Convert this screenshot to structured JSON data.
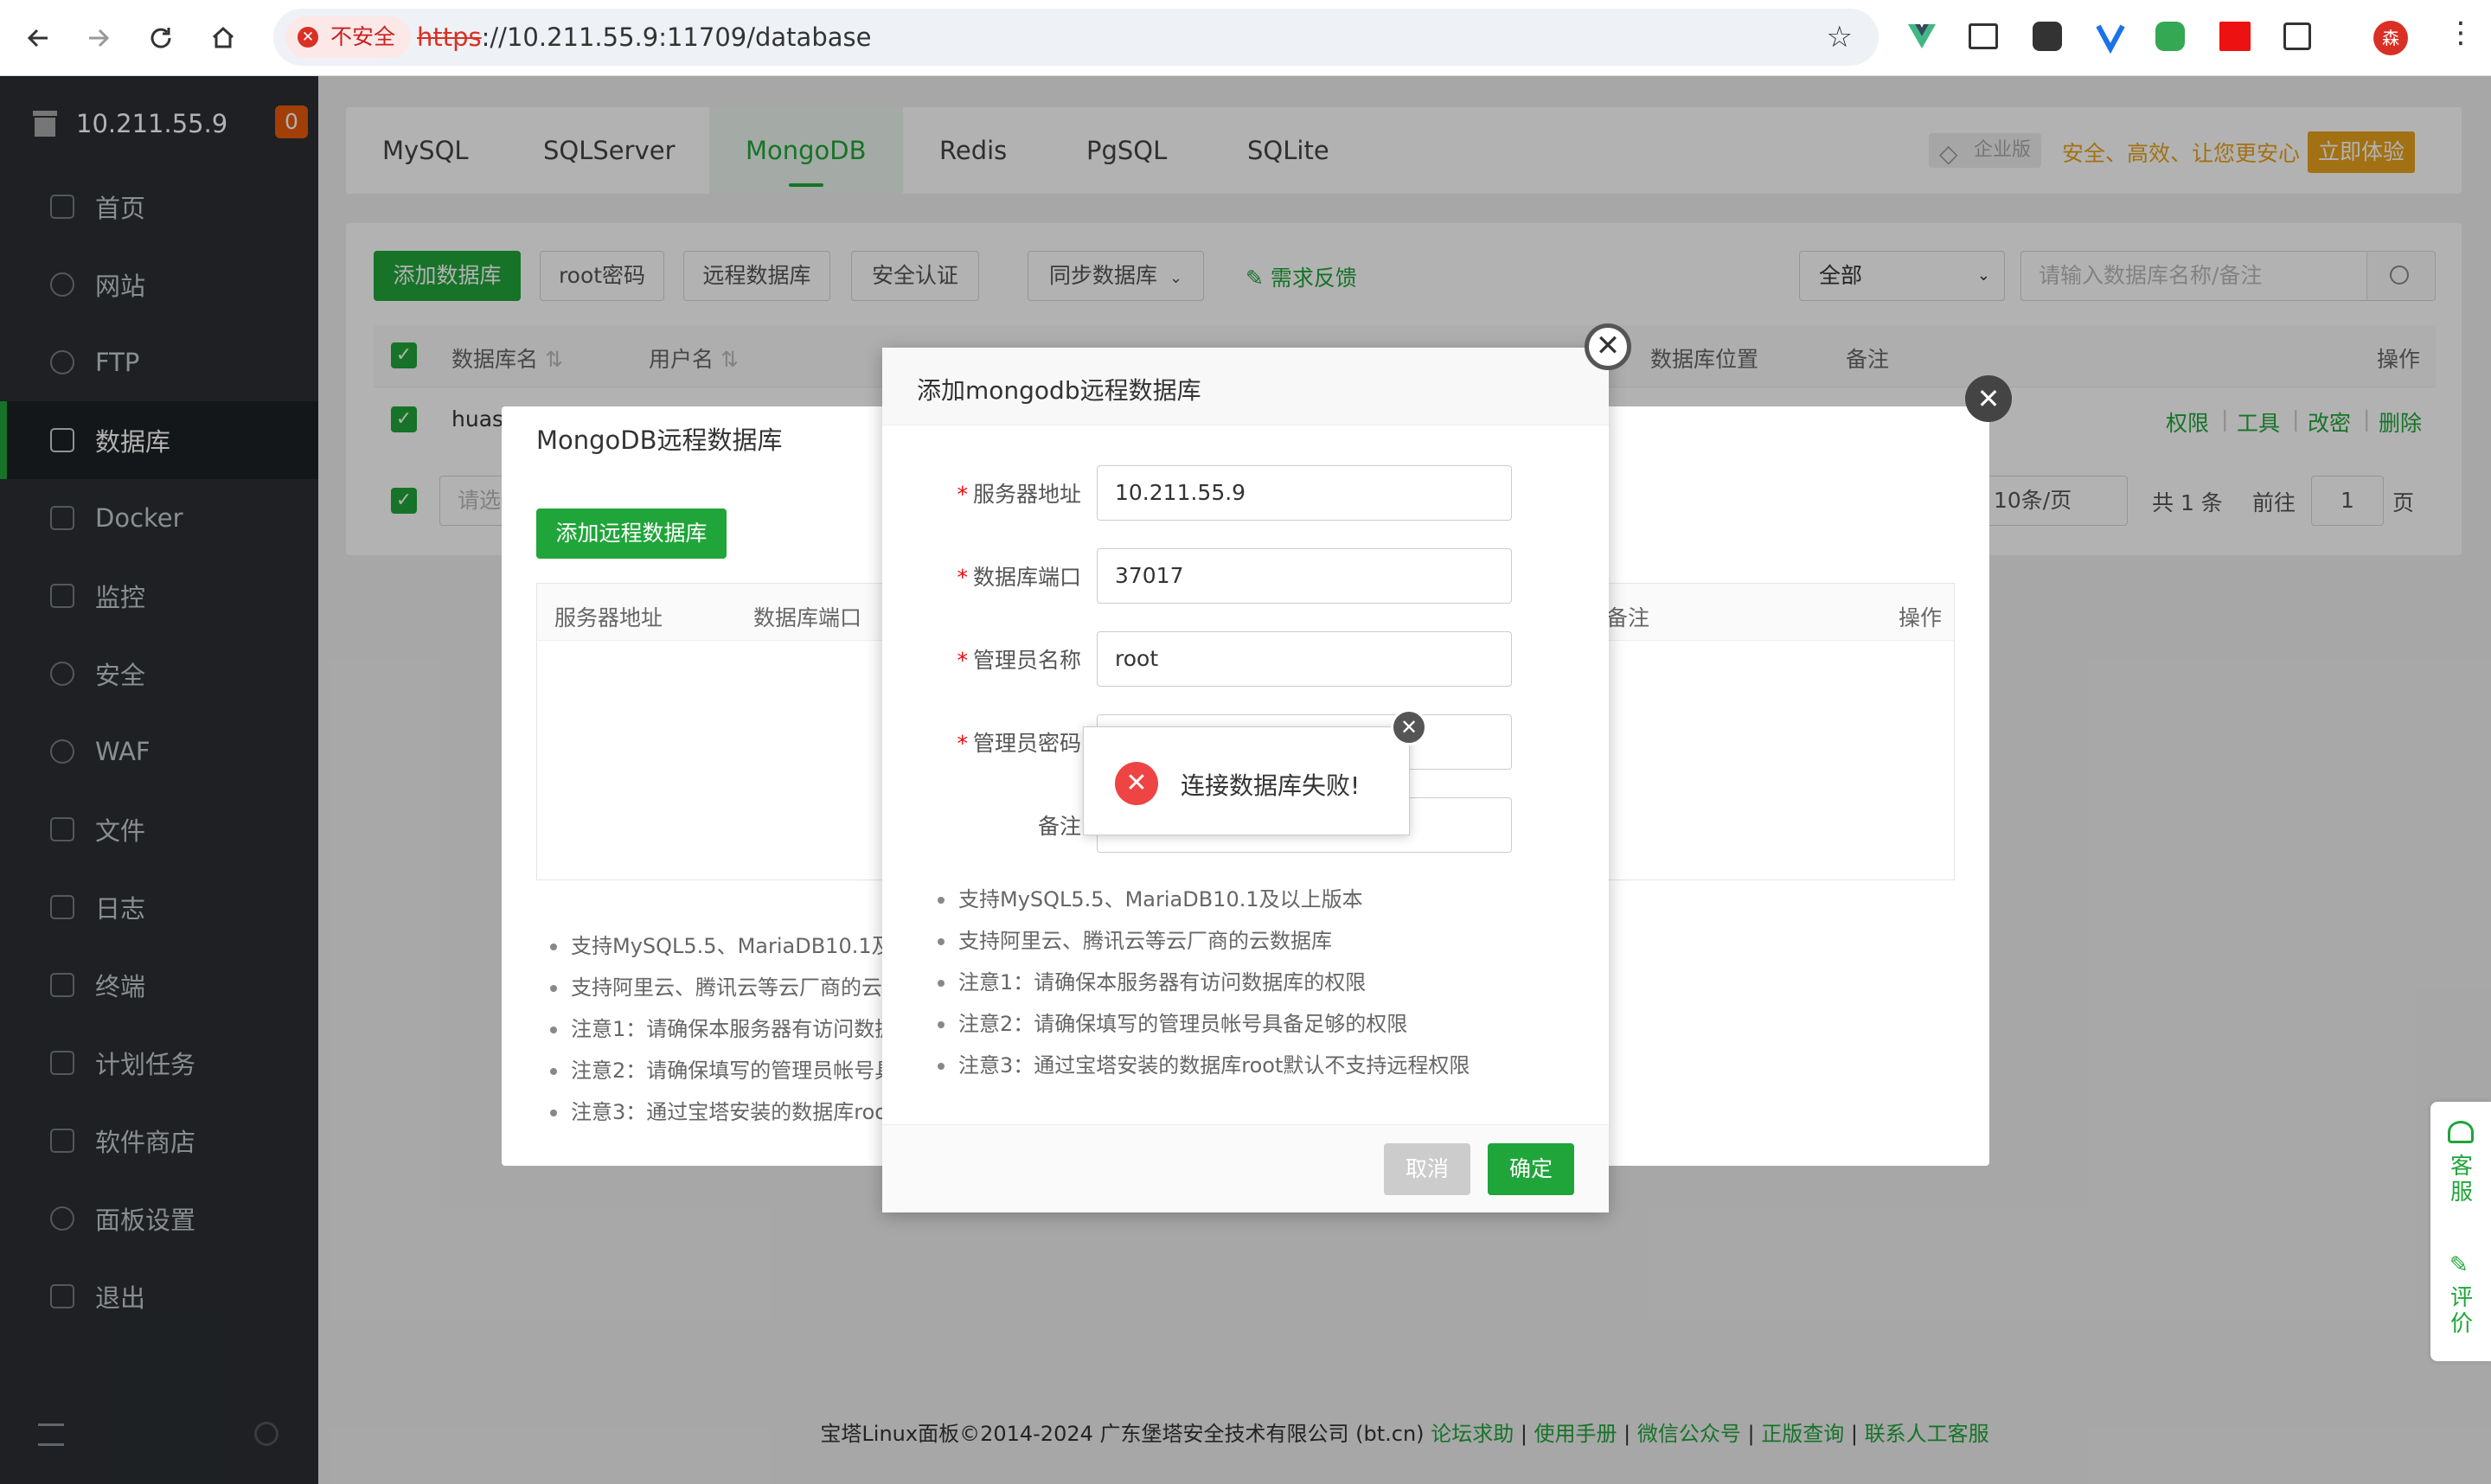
{
  "browser": {
    "security_label": "不安全",
    "url_scheme": "https",
    "url_rest": "://10.211.55.9:11709/database",
    "profile_initial": "森"
  },
  "sidebar": {
    "host": "10.211.55.9",
    "alert_count": "0",
    "items": [
      {
        "label": "首页",
        "icon": "home-icon"
      },
      {
        "label": "网站",
        "icon": "globe-icon"
      },
      {
        "label": "FTP",
        "icon": "ftp-icon"
      },
      {
        "label": "数据库",
        "icon": "database-icon"
      },
      {
        "label": "Docker",
        "icon": "docker-icon"
      },
      {
        "label": "监控",
        "icon": "monitor-icon"
      },
      {
        "label": "安全",
        "icon": "shield-icon"
      },
      {
        "label": "WAF",
        "icon": "waf-icon"
      },
      {
        "label": "文件",
        "icon": "folder-icon"
      },
      {
        "label": "日志",
        "icon": "log-icon"
      },
      {
        "label": "终端",
        "icon": "terminal-icon"
      },
      {
        "label": "计划任务",
        "icon": "calendar-icon"
      },
      {
        "label": "软件商店",
        "icon": "store-icon"
      },
      {
        "label": "面板设置",
        "icon": "gear-icon"
      },
      {
        "label": "退出",
        "icon": "logout-icon"
      }
    ]
  },
  "tabs": [
    "MySQL",
    "SQLServer",
    "MongoDB",
    "Redis",
    "PgSQL",
    "SQLite"
  ],
  "enterprise": {
    "badge": "企业版",
    "slogan": "安全、高效、让您更安心",
    "cta": "立即体验"
  },
  "toolbar": {
    "add_db": "添加数据库",
    "root_pwd": "root密码",
    "remote_db": "远程数据库",
    "auth": "安全认证",
    "sync_db": "同步数据库",
    "feedback": "需求反馈",
    "filter_value": "全部",
    "search_placeholder": "请输入数据库名称/备注"
  },
  "table": {
    "headers": {
      "name": "数据库名",
      "user": "用户名",
      "location": "数据库位置",
      "remark": "备注",
      "ops": "操作"
    },
    "row_name": "huase",
    "row_ops": [
      "权限",
      "工具",
      "改密",
      "删除"
    ]
  },
  "pagination": {
    "page_size": "10条/页",
    "total": "共 1 条",
    "goto": "前往",
    "page": "1",
    "page_unit": "页",
    "select_placeholder": "请选"
  },
  "remote_dialog": {
    "title": "MongoDB远程数据库",
    "add_button": "添加远程数据库",
    "headers": {
      "server": "服务器地址",
      "port": "数据库端口",
      "remark": "备注",
      "ops": "操作"
    },
    "tips": [
      "支持MySQL5.5、MariaDB10.1及以",
      "支持阿里云、腾讯云等云厂商的云",
      "注意1：请确保本服务器有访问数据",
      "注意2：请确保填写的管理员帐号具",
      "注意3：通过宝塔安装的数据库roo"
    ]
  },
  "add_dialog": {
    "title": "添加mongodb远程数据库",
    "fields": [
      {
        "label": "服务器地址",
        "required": true,
        "value": "10.211.55.9"
      },
      {
        "label": "数据库端口",
        "required": true,
        "value": "37017"
      },
      {
        "label": "管理员名称",
        "required": true,
        "value": "root"
      },
      {
        "label": "管理员密码",
        "required": true,
        "value": ""
      },
      {
        "label": "备注",
        "required": false,
        "value": ""
      }
    ],
    "tips": [
      "支持MySQL5.5、MariaDB10.1及以上版本",
      "支持阿里云、腾讯云等云厂商的云数据库",
      "注意1：请确保本服务器有访问数据库的权限",
      "注意2：请确保填写的管理员帐号具备足够的权限",
      "注意3：通过宝塔安装的数据库root默认不支持远程权限"
    ],
    "cancel": "取消",
    "confirm": "确定"
  },
  "toast": {
    "message": "连接数据库失败!"
  },
  "side_float": {
    "service": "客服",
    "rate": "评价"
  },
  "footer": {
    "copyright": "宝塔Linux面板©2014-2024 广东堡塔安全技术有限公司 (bt.cn)",
    "links": [
      "论坛求助",
      "使用手册",
      "微信公众号",
      "正版查询",
      "联系人工客服"
    ]
  },
  "colors": {
    "brand": "#20a53a",
    "sidebar": "#2b2f33",
    "danger": "#ef4444",
    "warning": "#e8590c"
  }
}
